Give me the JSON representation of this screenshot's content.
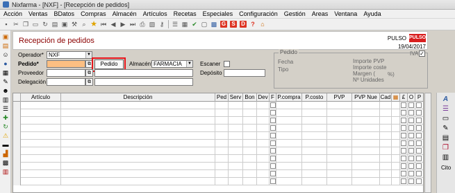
{
  "window": {
    "title": "Nixfarma - [NXF] - [Recepción de pedidos]"
  },
  "menu": [
    "Acción",
    "Ventas",
    "BDatos",
    "Compras",
    "Almacén",
    "Artículos",
    "Recetas",
    "Especiales",
    "Configuración",
    "Gestión",
    "Areas",
    "Ventana",
    "Ayuda"
  ],
  "toolbar": {
    "red_badges": [
      "G",
      "S",
      "D"
    ],
    "help_label": "?"
  },
  "form": {
    "title": "Recepción de pedidos",
    "brand": "PULSO",
    "logo_text": "PULSO",
    "date": "19/04/2017",
    "operador_label": "Operador*",
    "operador_value": "NXF",
    "pedido_label": "Pedido*",
    "pedido_value": "",
    "proveedor_label": "Proveedor",
    "delegacion_label": "Delegación",
    "pedido_cito_button": "Pedido Cito.",
    "almacen_label": "Almacén*",
    "almacen_value": "FARMACIA",
    "escaner_label": "Escaner",
    "deposito_label": "Depósito",
    "pedido_group": "Pedido",
    "fecha_label": "Fecha",
    "tipo_label": "Tipo",
    "iva_label": "IVA",
    "importe_pvp_label": "Importe PVP",
    "importe_coste_label": "Importe coste",
    "margen_label": "Margen (",
    "margen_pct": "%)",
    "unidades_label": "Nº Unidades"
  },
  "grid": {
    "columns": [
      "Artículo",
      "Descripción",
      "Ped",
      "Serv",
      "Bon",
      "Dev",
      "F",
      "P.compra",
      "P.costo",
      "PVP",
      "PVP Nue",
      "Cad",
      "",
      "£",
      "O",
      "P"
    ],
    "rows": 11
  },
  "rightbar": {
    "cito_label": "Cito"
  }
}
